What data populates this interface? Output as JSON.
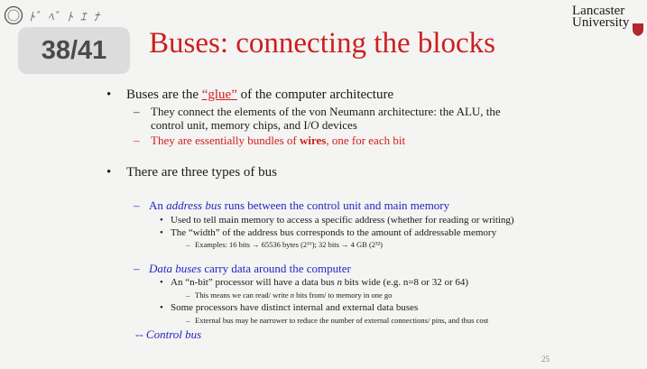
{
  "page_counter": "38/41",
  "title": "Buses: connecting the blocks",
  "university": {
    "line1": "Lancaster",
    "line2": "University"
  },
  "content": {
    "b1_pre": "Buses are the ",
    "b1_glue": "“glue”",
    "b1_post": " of the computer architecture",
    "b1_s1_l1": "They connect the elements of the von Neumann architecture: the ALU, the",
    "b1_s1_l2": "control unit, memory chips, and I/O devices",
    "b1_s2_pre": "They are essentially bundles of ",
    "b1_s2_bold": "wires",
    "b1_s2_post": ", one for each bit",
    "b2": "There are three types of bus",
    "addr_pre": "An ",
    "addr_em": "address bus",
    "addr_post": " runs between the control unit and main memory",
    "addr_p1": "Used to tell main memory to access a specific address (whether for reading or writing)",
    "addr_p2": "The “width” of the address bus corresponds to the amount of addressable memory",
    "addr_p2_ex": "Examples: 16 bits → 65536 bytes (2¹⁶); 32 bits → 4 GB (2³²)",
    "data_em": "Data buses",
    "data_post": " carry data around the computer",
    "data_p1_pre": "An “n-bit” processor will have a data bus ",
    "data_p1_n": "n",
    "data_p1_post": " bits wide (e.g. n=8 or 32 or 64)",
    "data_p1_sub_pre": "This means we can read/ write ",
    "data_p1_sub_n": "n",
    "data_p1_sub_post": " bits from/ to memory in one go",
    "data_p2": "Some processors have distinct internal and external data buses",
    "data_p2_sub": "External bus may be narrower to reduce the number of external connections/ pins, and thus cost",
    "control": "-- Control bus"
  },
  "marks": {
    "bullet": "•",
    "dash": "–"
  },
  "page_number": "25"
}
